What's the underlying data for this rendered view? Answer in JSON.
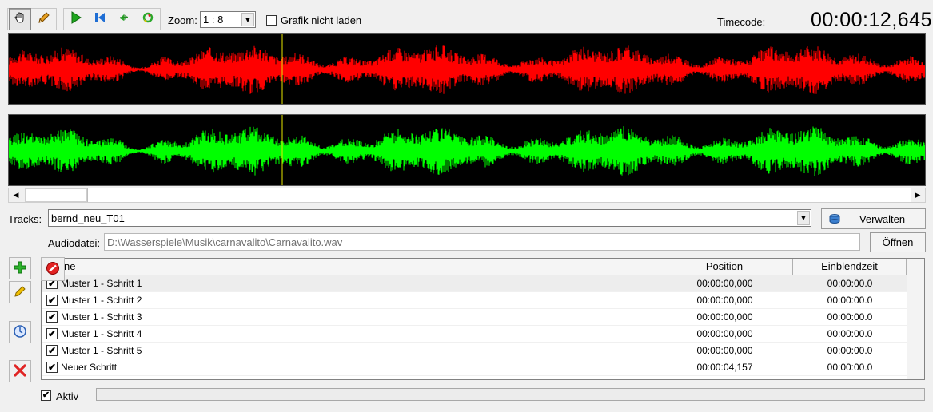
{
  "toolbar": {
    "icons": [
      "hand-icon",
      "pencil-icon",
      "play-icon",
      "skip-to-start-icon",
      "green-arrows-icon",
      "recycle-icon"
    ],
    "zoom_label": "Zoom:",
    "zoom_value": "1 : 8",
    "no_graphics_label": "Grafik nicht laden",
    "no_graphics_checked": false,
    "timecode_label": "Timecode:",
    "timecode_value": "00:00:12,645"
  },
  "waveform": {
    "left_channel_color": "#ff0000",
    "right_channel_color": "#00ff00",
    "playhead_color": "#e8e800"
  },
  "tracks": {
    "label": "Tracks:",
    "value": "bernd_neu_T01",
    "manage_label": "Verwalten"
  },
  "audio": {
    "label": "Audiodatei:",
    "path": "D:\\Wasserspiele\\Musik\\carnavalito\\Carnavalito.wav",
    "open_label": "Öffnen"
  },
  "steps": {
    "columns": [
      "ne",
      "Position",
      "Einblendzeit"
    ],
    "rows": [
      {
        "checked": true,
        "name": "Muster 1 - Schritt 1",
        "position": "00:00:00,000",
        "fade": "00:00:00.0"
      },
      {
        "checked": true,
        "name": "Muster 1 - Schritt 2",
        "position": "00:00:00,000",
        "fade": "00:00:00.0"
      },
      {
        "checked": true,
        "name": "Muster 1 - Schritt 3",
        "position": "00:00:00,000",
        "fade": "00:00:00.0"
      },
      {
        "checked": true,
        "name": "Muster 1 - Schritt 4",
        "position": "00:00:00,000",
        "fade": "00:00:00.0"
      },
      {
        "checked": true,
        "name": "Muster 1 - Schritt 5",
        "position": "00:00:00,000",
        "fade": "00:00:00.0"
      },
      {
        "checked": true,
        "name": "Neuer Schritt",
        "position": "00:00:04,157",
        "fade": "00:00:00.0"
      }
    ]
  },
  "side_icons": [
    "add-icon",
    "edit-pencil-icon",
    "clock-icon",
    "delete-icon"
  ],
  "aktiv": {
    "label": "Aktiv",
    "checked": true
  }
}
